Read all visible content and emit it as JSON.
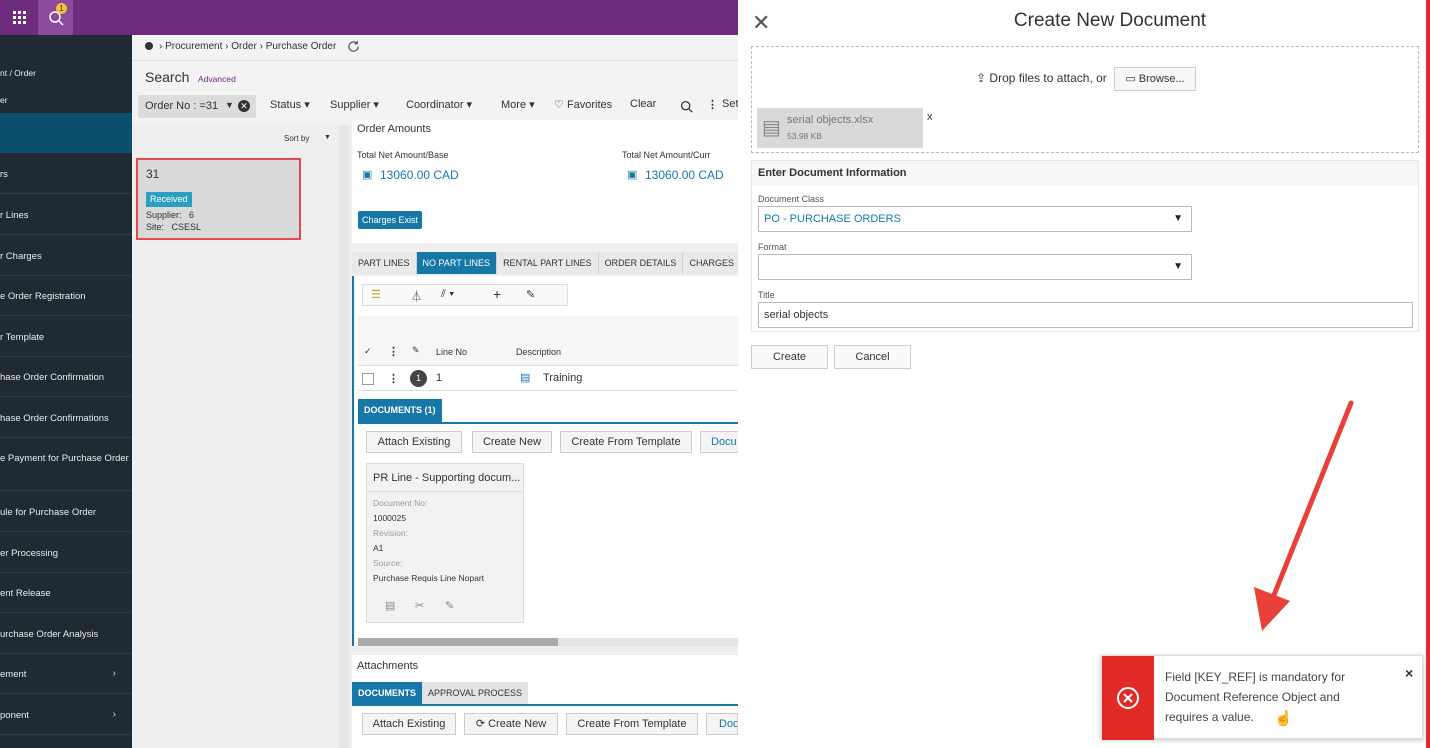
{
  "topbar": {
    "badge_count": "1"
  },
  "nav": {
    "items": [
      {
        "label": "nt / Order"
      },
      {
        "label": "er"
      },
      {
        "label": "rs"
      },
      {
        "label": "r Lines"
      },
      {
        "label": "r Charges"
      },
      {
        "label": "e Order Registration"
      },
      {
        "label": "r Template"
      },
      {
        "label": "hase Order Confirmation"
      },
      {
        "label": "hase Order Confirmations"
      },
      {
        "label": "e Payment for Purchase Order"
      },
      {
        "label": "ule for Purchase Order"
      },
      {
        "label": "er Processing"
      },
      {
        "label": "ent Release"
      },
      {
        "label": "urchase Order Analysis"
      },
      {
        "label": "ement"
      },
      {
        "label": "ponent"
      }
    ]
  },
  "breadcrumb": {
    "text": "Procurement › Order › Purchase Order"
  },
  "search": {
    "title": "Search",
    "advanced": "Advanced",
    "order_filter": "Order No : =31",
    "status": "Status",
    "supplier": "Supplier",
    "coordinator": "Coordinator",
    "more": "More",
    "favorites": "Favorites",
    "clear": "Clear",
    "set": "Set"
  },
  "list": {
    "sort_by": "Sort by",
    "card": {
      "order_no": "31",
      "status": "Received",
      "supplier": "Supplier:   6",
      "site": "Site:   CSESL"
    }
  },
  "order_amounts": {
    "title": "Order Amounts",
    "base_label": "Total Net Amount/Base",
    "base_value": "13060.00 CAD",
    "curr_label": "Total Net Amount/Curr",
    "curr_value": "13060.00 CAD",
    "charges_badge": "Charges Exist"
  },
  "tabs": [
    "PART LINES",
    "NO PART LINES",
    "RENTAL PART LINES",
    "ORDER DETAILS",
    "CHARGES"
  ],
  "lines_table": {
    "col_line_no": "Line No",
    "col_description": "Description",
    "row": {
      "badge": "1",
      "line_no": "1",
      "description": "Training"
    }
  },
  "documents": {
    "tab": "DOCUMENTS (1)",
    "attach_existing": "Attach Existing",
    "create_new": "Create New",
    "create_from_template": "Create From Template",
    "docu": "Docu",
    "doc_card": {
      "title": "PR Line - Supporting docum...",
      "doc_no_label": "Document No:",
      "doc_no": "1000025",
      "revision_label": "Revision:",
      "revision": "A1",
      "source_label": "Source:",
      "source": "Purchase Requis Line Nopart"
    }
  },
  "attachments": {
    "title": "Attachments",
    "tab_documents": "DOCUMENTS",
    "tab_approval": "APPROVAL PROCESS",
    "attach_existing": "Attach Existing",
    "create_new": "Create New",
    "create_from_template": "Create From Template",
    "doc": "Doc"
  },
  "dialog": {
    "title": "Create New Document",
    "drop_text": "Drop files to attach, or",
    "browse": "Browse...",
    "file_name": "serial objects.xlsx",
    "file_size": "53.98 KB",
    "remove_file": "x",
    "info_header": "Enter Document Information",
    "doc_class_label": "Document Class",
    "doc_class_value": "PO - PURCHASE ORDERS",
    "format_label": "Format",
    "format_value": "",
    "title_label": "Title",
    "title_value": "serial objects",
    "create": "Create",
    "cancel": "Cancel"
  },
  "toast": {
    "message": "Field [KEY_REF] is mandatory for Document Reference Object and requires a value.",
    "close": "×"
  },
  "colors": {
    "topbar": "#6e2c7e",
    "nav": "#1f2a33",
    "accent": "#1778a8",
    "error": "#e02b27",
    "status_badge": "#2b9fbf"
  }
}
